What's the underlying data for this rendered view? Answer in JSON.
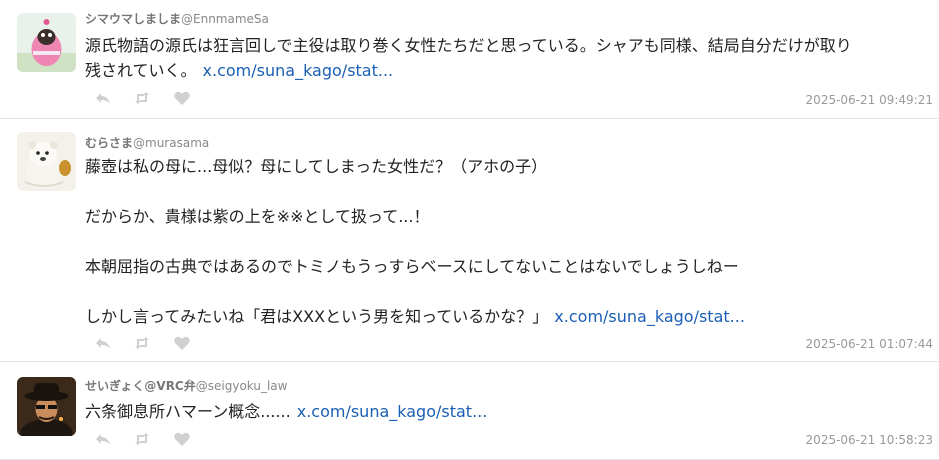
{
  "tweets": [
    {
      "display_name": "シマウマしましま",
      "handle": "@EnnmameSa",
      "paragraphs": [
        "源氏物語の源氏は狂言回しで主役は取り巻く女性たちだと思っている。シャアも同様、結局自分だけが取り",
        "残されていく。"
      ],
      "link": "x.com/suna_kago/stat...",
      "timestamp": "2025-06-21 09:49:21",
      "avatar_icon": "pink-costume-character-avatar"
    },
    {
      "display_name": "むらさま",
      "handle": "@murasama",
      "paragraphs": [
        "藤壺は私の母に...母似？母にしてしまった女性だ？（アホの子）",
        "だからか、貴様は紫の上を※※として扱って...！",
        "本朝屈指の古典ではあるのでトミノもうっすらベースにしてないことはないでしょうしねー",
        "しかし言ってみたいね「君はXXXという男を知っているかな？」"
      ],
      "link": "x.com/suna_kago/stat...",
      "timestamp": "2025-06-21 01:07:44",
      "avatar_icon": "white-bear-avatar"
    },
    {
      "display_name": "せいぎょく@VRC弁",
      "handle": "@seigyoku_law",
      "paragraphs": [
        "六条御息所ハマーン概念......"
      ],
      "link": "x.com/suna_kago/stat...",
      "timestamp": "2025-06-21 10:58:23",
      "avatar_icon": "man-in-fedora-avatar"
    }
  ],
  "actions": {
    "reply_icon": "reply-icon",
    "retweet_icon": "retweet-icon",
    "like_icon": "heart-icon"
  },
  "colors": {
    "link": "#1a5fb4",
    "icon": "#d0d0d0",
    "timestamp": "#999999",
    "divider": "#e6e6e6"
  }
}
